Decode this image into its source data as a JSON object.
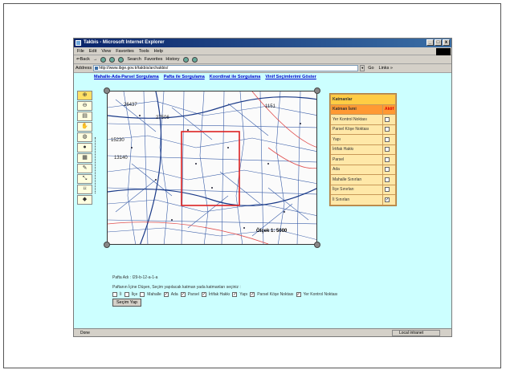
{
  "window": {
    "title": "Takbis - Microsoft Internet Explorer",
    "buttons": [
      "_",
      "□",
      "x"
    ]
  },
  "menu": [
    "File",
    "Edit",
    "View",
    "Favorites",
    "Tools",
    "Help"
  ],
  "toolbar": [
    "⇐Back",
    "→",
    "Search",
    "Favorites",
    "History"
  ],
  "address": {
    "label": "Address",
    "value": "http://www.ibge.gov.tr/takbis/archakbis/",
    "go": "Go",
    "links": "Links »"
  },
  "nav_links": [
    "Mahalle-Ada-Parsel Sorgulama",
    "Pafta ile Sorgulama",
    "Koordinat ile Sorgulama",
    "Vinif Seçimlerimi Göster"
  ],
  "layers": {
    "header": "Katmanlar",
    "col_name": "Katman İsmi",
    "col_active": "Aktif",
    "items": [
      {
        "name": "Yer Kontrol Noktası",
        "checked": false
      },
      {
        "name": "Parsel Köşe Noktası",
        "checked": false
      },
      {
        "name": "Yapı",
        "checked": false
      },
      {
        "name": "İrtifak Hakkı",
        "checked": false
      },
      {
        "name": "Parsel",
        "checked": false
      },
      {
        "name": "Ada",
        "checked": false
      },
      {
        "name": "Mahalle Sınırları",
        "checked": false
      },
      {
        "name": "İlçe Sınırları",
        "checked": false
      },
      {
        "name": "İl Sınırları",
        "checked": true
      }
    ]
  },
  "footer": {
    "pafta": "Pafta Adı : I29-b-12-a-1-a",
    "prompt": "Paftanın İçine Düşen, Seçim yapılacak katman yada katmanları seçiniz :",
    "checks": [
      "İl",
      "İlçe",
      "Mahalle",
      "Ada",
      "Parsel",
      "İrtifak Hakkı",
      "Yapı",
      "Parsel Köşe Noktası",
      "Yer Kontrol Noktası"
    ],
    "button": "Seçim Yap"
  },
  "status": {
    "left": "Done",
    "right": "Local intranet"
  },
  "map": {
    "scale_label": "Ölçek 1: 5000",
    "parcels": [
      "26437",
      "27506",
      "15230",
      "13140",
      "1151"
    ]
  }
}
